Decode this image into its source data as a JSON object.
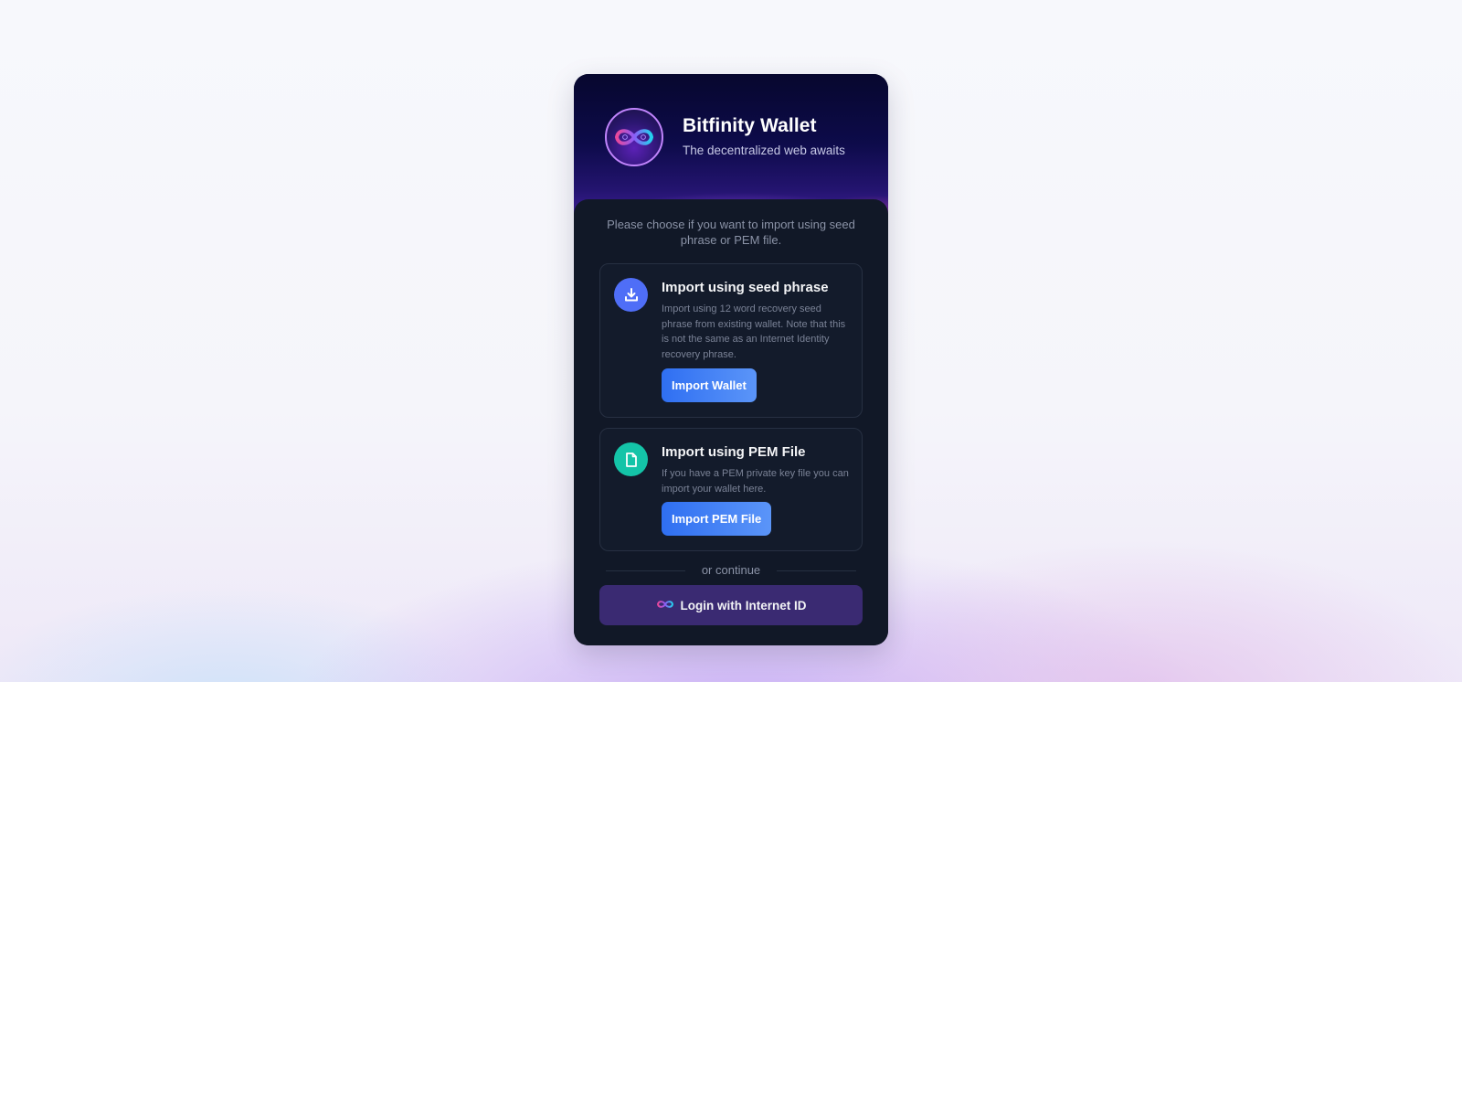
{
  "brand": {
    "title": "Bitfinity Wallet",
    "subtitle": "The decentralized web awaits",
    "logo_icon": "infinity-logo-icon"
  },
  "intro_text": "Please choose if you want to import using seed phrase or PEM file.",
  "options": [
    {
      "icon": "download-icon",
      "icon_color": "#4f6ef7",
      "title": "Import using seed phrase",
      "description": "Import using 12 word recovery seed phrase from existing wallet. Note that this is not the same as an Internet Identity recovery phrase.",
      "button_label": "Import Wallet"
    },
    {
      "icon": "file-icon",
      "icon_color": "#14c4a8",
      "title": "Import using PEM File",
      "description": "If you have a PEM private key file you can import your wallet here.",
      "button_label": "Import PEM File"
    }
  ],
  "divider_text": "or continue",
  "login": {
    "label": "Login with Internet ID",
    "icon": "infinity-icon"
  },
  "colors": {
    "card_bg": "#111827",
    "button_blue": "#2f6ff2",
    "login_button_bg": "#3a2a72"
  }
}
